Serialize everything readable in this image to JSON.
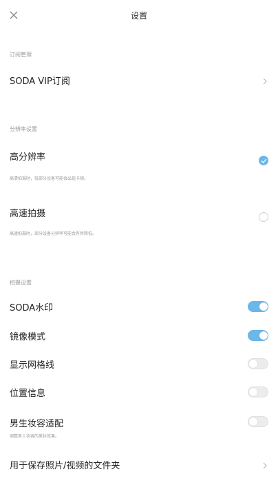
{
  "header": {
    "title": "设置",
    "close_icon": "close-icon"
  },
  "sections": {
    "subscription": {
      "label": "订阅管理",
      "items": [
        {
          "label": "SODA VIP订阅",
          "icon": "chevron-right-icon"
        }
      ]
    },
    "resolution": {
      "label": "分辨率设置",
      "items": [
        {
          "label": "高分辨率",
          "desc": "高清拍摄时，低部分设备可能会出现卡顿。",
          "selected": true
        },
        {
          "label": "高速拍摄",
          "desc": "高速拍摄时，部分设备分辨率可能会有所降低。",
          "selected": false
        }
      ]
    },
    "camera": {
      "label": "拍摄设置",
      "items": [
        {
          "label": "SODA水印",
          "on": true
        },
        {
          "label": "镜像模式",
          "on": true
        },
        {
          "label": "显示网格线",
          "on": false
        },
        {
          "label": "位置信息",
          "on": false
        },
        {
          "label": "男生妆容适配",
          "desc": "调整男士妆容的美妆效果。",
          "on": false
        }
      ]
    },
    "folder": {
      "label": "用于保存照片/视频的文件夹",
      "icon": "chevron-right-icon"
    }
  },
  "colors": {
    "accent": "#6ab7e8",
    "toggle_off": "#ececec",
    "muted_text": "#9a9a9a"
  }
}
